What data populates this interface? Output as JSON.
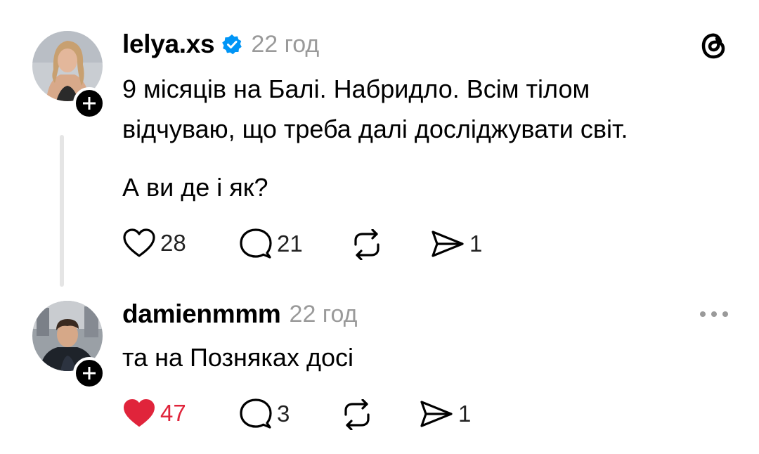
{
  "post": {
    "username": "lelya.xs",
    "verified": true,
    "timestamp": "22 год",
    "lines": [
      "9 місяців на Балі. Набридло. Всім тілом",
      "відчуваю, що треба далі досліджувати світ."
    ],
    "question": "А ви де і як?",
    "actions": {
      "likes": "28",
      "comments": "21",
      "shares": "1"
    },
    "app_logo": "threads-logo-icon"
  },
  "reply": {
    "username": "damienmmm",
    "timestamp": "22 год",
    "text": "та на Позняках досі",
    "actions": {
      "likes": "47",
      "liked": true,
      "comments": "3",
      "shares": "1"
    }
  },
  "colors": {
    "verified": "#0095f6",
    "liked": "#e0243b",
    "muted": "#9a9a9a"
  }
}
